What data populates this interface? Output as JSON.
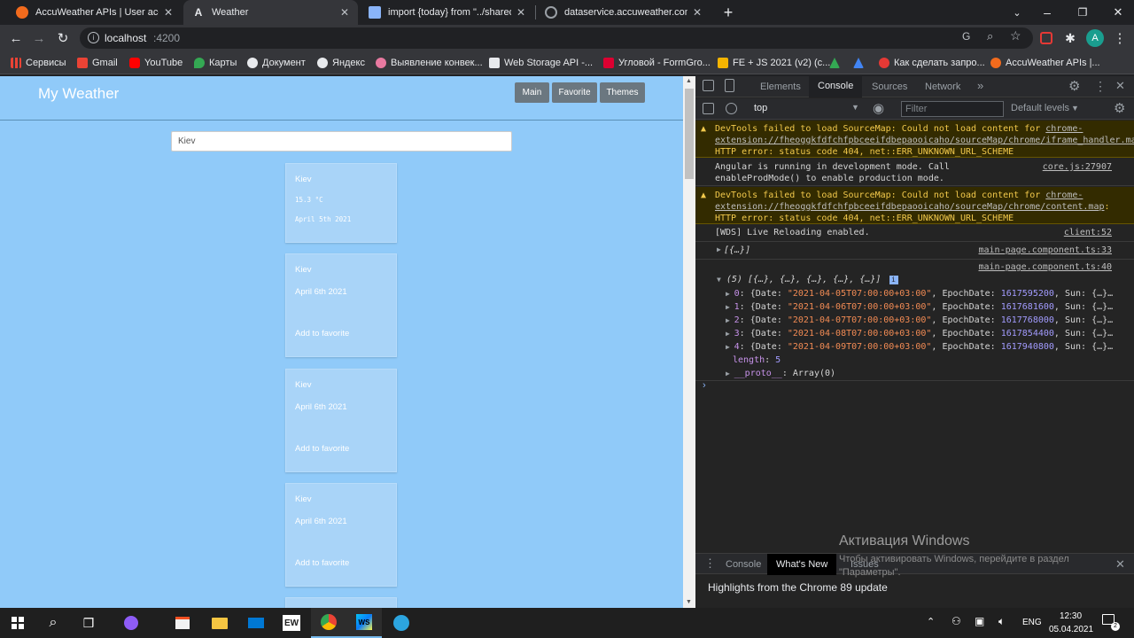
{
  "tabs": [
    {
      "title": "AccuWeather APIs | User account",
      "favicon": "accuweather-icon",
      "color": "#f26b1d"
    },
    {
      "title": "Weather",
      "favicon": "angular-icon",
      "color": "#e8eaed"
    },
    {
      "title": "import {today} from \"../shared/in",
      "favicon": "document-icon",
      "color": "#8ab4f8"
    },
    {
      "title": "dataservice.accuweather.com/for",
      "favicon": "globe-icon",
      "color": "#9aa0a6"
    }
  ],
  "address": {
    "url": "localhost",
    "port": ":4200"
  },
  "profile": "A",
  "bookmarks": [
    {
      "label": "Сервисы",
      "color": "#ea4335"
    },
    {
      "label": "Gmail",
      "color": "#ea4335"
    },
    {
      "label": "YouTube",
      "color": "#ff0000"
    },
    {
      "label": "Карты",
      "color": "#34a853"
    },
    {
      "label": "Документ",
      "color": "#e8eaed"
    },
    {
      "label": "Яндекс",
      "color": "#e8eaed"
    },
    {
      "label": "Выявление конвек...",
      "color": "#e879a0"
    },
    {
      "label": "Web Storage API -...",
      "color": "#e8eaed"
    },
    {
      "label": "Угловой - FormGro...",
      "color": "#dd0031"
    },
    {
      "label": "FE + JS 2021 (v2) (c...",
      "color": "#f4b400"
    },
    {
      "label": "",
      "color": "#34a853"
    },
    {
      "label": "",
      "color": "#4285f4"
    },
    {
      "label": "Как сделать запро...",
      "color": "#e53935"
    },
    {
      "label": "AccuWeather APIs |...",
      "color": "#f26b1d"
    }
  ],
  "app": {
    "brand": "My Weather",
    "nav": [
      "Main",
      "Favorite",
      "Themes"
    ],
    "search_value": "Kiev",
    "cards": [
      {
        "city": "Kiev",
        "temp": "15.3 °C",
        "date": "April 5th 2021",
        "action": ""
      },
      {
        "city": "Kiev",
        "temp": "",
        "date": "April 6th 2021",
        "action": "Add to favorite"
      },
      {
        "city": "Kiev",
        "temp": "",
        "date": "April 6th 2021",
        "action": "Add to favorite"
      },
      {
        "city": "Kiev",
        "temp": "",
        "date": "April 6th 2021",
        "action": "Add to favorite"
      }
    ]
  },
  "devtools": {
    "tabs": [
      "Elements",
      "Console",
      "Sources",
      "Network"
    ],
    "context": "top",
    "filter_placeholder": "Filter",
    "levels": "Default levels",
    "logs": {
      "w1_text": "DevTools failed to load SourceMap: Could not load content for ",
      "w1_link": "chrome-extension://fheoggkfdfchfpbceeifdbepaooicaho/sourceMap/chrome/iframe_handler.map",
      "w1_tail": ": HTTP error: status code 404, net::ERR_UNKNOWN_URL_SCHEME",
      "a_text": "Angular is running in development mode. Call enableProdMode() to enable production mode.",
      "a_src": "core.js:27907",
      "w2_text": "DevTools failed to load SourceMap: Could not load content for ",
      "w2_link": "chrome-extension://fheoggkfdfchfpbceeifdbepaooicaho/sourceMap/chrome/content.map",
      "w2_tail": ": HTTP error: status code 404, net::ERR_UNKNOWN_URL_SCHEME",
      "wds_text": "[WDS] Live Reloading enabled.",
      "wds_src": "client:52",
      "o1_text": "[{…}]",
      "o1_src": "main-page.component.ts:33",
      "o2_src": "main-page.component.ts:40",
      "o2_head": "(5) [{…}, {…}, {…}, {…}, {…}]",
      "items": [
        {
          "i": "0",
          "date": "\"2021-04-05T07:00:00+03:00\"",
          "epoch": "1617595200"
        },
        {
          "i": "1",
          "date": "\"2021-04-06T07:00:00+03:00\"",
          "epoch": "1617681600"
        },
        {
          "i": "2",
          "date": "\"2021-04-07T07:00:00+03:00\"",
          "epoch": "1617768000"
        },
        {
          "i": "3",
          "date": "\"2021-04-08T07:00:00+03:00\"",
          "epoch": "1617854400"
        },
        {
          "i": "4",
          "date": "\"2021-04-09T07:00:00+03:00\"",
          "epoch": "1617940800"
        }
      ],
      "length_key": "length",
      "length_val": "5",
      "proto_key": "__proto__",
      "proto_val": "Array(0)"
    },
    "drawer_tabs": [
      "Console",
      "What's New",
      "Issues"
    ],
    "highlights": "Highlights from the Chrome 89 update"
  },
  "watermark": {
    "title": "Активация Windows",
    "line1": "Чтобы активировать Windows, перейдите в раздел",
    "line2": "\"Параметры\"."
  },
  "taskbar": {
    "lang": "ENG",
    "time": "12:30",
    "date": "05.04.2021"
  }
}
